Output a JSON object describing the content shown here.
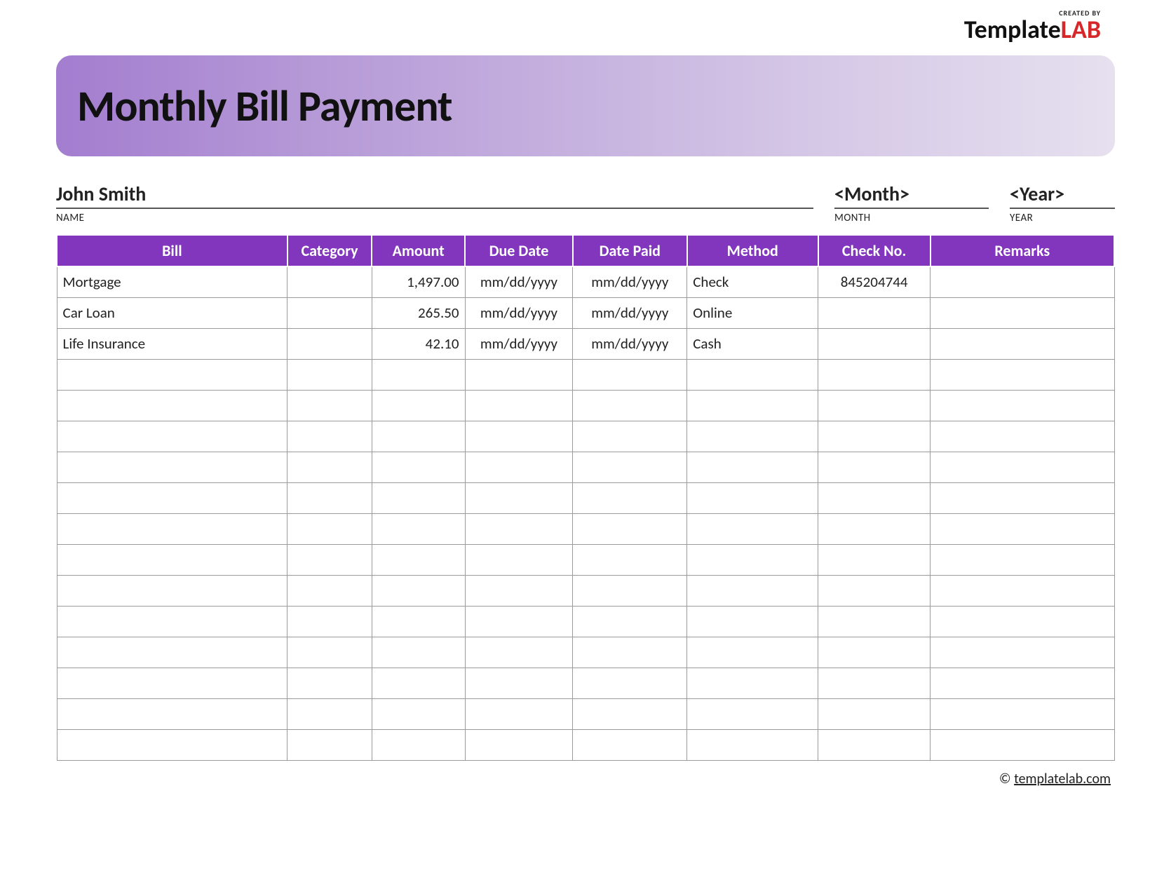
{
  "brand": {
    "created": "CREATED BY",
    "logo_main": "Template",
    "logo_accent": "LAB"
  },
  "title": "Monthly Bill Payment",
  "meta": {
    "name_value": "John Smith",
    "name_label": "NAME",
    "month_value": "<Month>",
    "month_label": "MONTH",
    "year_value": "<Year>",
    "year_label": "YEAR"
  },
  "columns": {
    "bill": "Bill",
    "category": "Category",
    "amount": "Amount",
    "due": "Due Date",
    "paid": "Date Paid",
    "method": "Method",
    "check": "Check No.",
    "remarks": "Remarks"
  },
  "rows": [
    {
      "bill": "Mortgage",
      "category": "",
      "amount": "1,497.00",
      "due": "mm/dd/yyyy",
      "paid": "mm/dd/yyyy",
      "method": "Check",
      "check": "845204744",
      "remarks": ""
    },
    {
      "bill": "Car Loan",
      "category": "",
      "amount": "265.50",
      "due": "mm/dd/yyyy",
      "paid": "mm/dd/yyyy",
      "method": "Online",
      "check": "",
      "remarks": ""
    },
    {
      "bill": "Life Insurance",
      "category": "",
      "amount": "42.10",
      "due": "mm/dd/yyyy",
      "paid": "mm/dd/yyyy",
      "method": "Cash",
      "check": "",
      "remarks": ""
    },
    {
      "bill": "",
      "category": "",
      "amount": "",
      "due": "",
      "paid": "",
      "method": "",
      "check": "",
      "remarks": ""
    },
    {
      "bill": "",
      "category": "",
      "amount": "",
      "due": "",
      "paid": "",
      "method": "",
      "check": "",
      "remarks": ""
    },
    {
      "bill": "",
      "category": "",
      "amount": "",
      "due": "",
      "paid": "",
      "method": "",
      "check": "",
      "remarks": ""
    },
    {
      "bill": "",
      "category": "",
      "amount": "",
      "due": "",
      "paid": "",
      "method": "",
      "check": "",
      "remarks": ""
    },
    {
      "bill": "",
      "category": "",
      "amount": "",
      "due": "",
      "paid": "",
      "method": "",
      "check": "",
      "remarks": ""
    },
    {
      "bill": "",
      "category": "",
      "amount": "",
      "due": "",
      "paid": "",
      "method": "",
      "check": "",
      "remarks": ""
    },
    {
      "bill": "",
      "category": "",
      "amount": "",
      "due": "",
      "paid": "",
      "method": "",
      "check": "",
      "remarks": ""
    },
    {
      "bill": "",
      "category": "",
      "amount": "",
      "due": "",
      "paid": "",
      "method": "",
      "check": "",
      "remarks": ""
    },
    {
      "bill": "",
      "category": "",
      "amount": "",
      "due": "",
      "paid": "",
      "method": "",
      "check": "",
      "remarks": ""
    },
    {
      "bill": "",
      "category": "",
      "amount": "",
      "due": "",
      "paid": "",
      "method": "",
      "check": "",
      "remarks": ""
    },
    {
      "bill": "",
      "category": "",
      "amount": "",
      "due": "",
      "paid": "",
      "method": "",
      "check": "",
      "remarks": ""
    },
    {
      "bill": "",
      "category": "",
      "amount": "",
      "due": "",
      "paid": "",
      "method": "",
      "check": "",
      "remarks": ""
    },
    {
      "bill": "",
      "category": "",
      "amount": "",
      "due": "",
      "paid": "",
      "method": "",
      "check": "",
      "remarks": ""
    }
  ],
  "footer": {
    "copyright": "©",
    "link": "templatelab.com"
  }
}
